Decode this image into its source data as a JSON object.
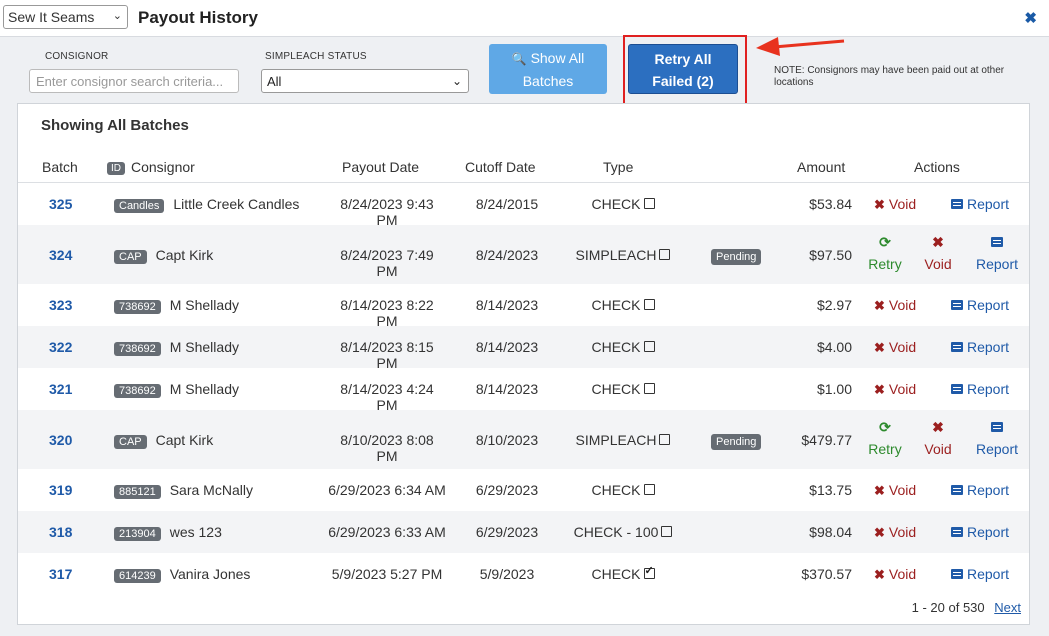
{
  "header": {
    "store_select": "Sew It Seams",
    "title": "Payout History",
    "close": "✖"
  },
  "filters": {
    "consignor_label": "CONSIGNOR",
    "consignor_placeholder": "Enter consignor search criteria...",
    "status_label": "SIMPLEACH STATUS",
    "status_value": "All",
    "show_all_line1": "Show All",
    "show_all_line2": "Batches",
    "retry_line1": "Retry All",
    "retry_line2": "Failed (2)",
    "note": "NOTE: Consignors may have been paid out at other locations"
  },
  "table": {
    "heading": "Showing All Batches",
    "columns": {
      "batch": "Batch",
      "id_badge": "ID",
      "consignor": "Consignor",
      "payout_date": "Payout Date",
      "cutoff_date": "Cutoff Date",
      "type": "Type",
      "amount": "Amount",
      "actions": "Actions"
    },
    "action_labels": {
      "void": "Void",
      "report": "Report",
      "retry": "Retry"
    },
    "rows": [
      {
        "batch": "325",
        "tag": "Candles",
        "consignor": "Little Creek Candles",
        "payout": "8/24/2023 9:43 PM",
        "cutoff": "8/24/2015",
        "type": "CHECK",
        "checked": false,
        "pending": "",
        "amount": "$53.84",
        "retry": false
      },
      {
        "batch": "324",
        "tag": "CAP",
        "consignor": "Capt Kirk",
        "payout": "8/24/2023 7:49 PM",
        "cutoff": "8/24/2023",
        "type": "SIMPLEACH",
        "checked": false,
        "pending": "Pending",
        "amount": "$97.50",
        "retry": true
      },
      {
        "batch": "323",
        "tag": "738692",
        "consignor": "M Shellady",
        "payout": "8/14/2023 8:22 PM",
        "cutoff": "8/14/2023",
        "type": "CHECK",
        "checked": false,
        "pending": "",
        "amount": "$2.97",
        "retry": false
      },
      {
        "batch": "322",
        "tag": "738692",
        "consignor": "M Shellady",
        "payout": "8/14/2023 8:15 PM",
        "cutoff": "8/14/2023",
        "type": "CHECK",
        "checked": false,
        "pending": "",
        "amount": "$4.00",
        "retry": false
      },
      {
        "batch": "321",
        "tag": "738692",
        "consignor": "M Shellady",
        "payout": "8/14/2023 4:24 PM",
        "cutoff": "8/14/2023",
        "type": "CHECK",
        "checked": false,
        "pending": "",
        "amount": "$1.00",
        "retry": false
      },
      {
        "batch": "320",
        "tag": "CAP",
        "consignor": "Capt Kirk",
        "payout": "8/10/2023 8:08 PM",
        "cutoff": "8/10/2023",
        "type": "SIMPLEACH",
        "checked": false,
        "pending": "Pending",
        "amount": "$479.77",
        "retry": true
      },
      {
        "batch": "319",
        "tag": "885121",
        "consignor": "Sara McNally",
        "payout": "6/29/2023 6:34 AM",
        "cutoff": "6/29/2023",
        "type": "CHECK",
        "checked": false,
        "pending": "",
        "amount": "$13.75",
        "retry": false
      },
      {
        "batch": "318",
        "tag": "213904",
        "consignor": "wes 123",
        "payout": "6/29/2023 6:33 AM",
        "cutoff": "6/29/2023",
        "type": "CHECK - 100",
        "checked": false,
        "pending": "",
        "amount": "$98.04",
        "retry": false
      },
      {
        "batch": "317",
        "tag": "614239",
        "consignor": "Vanira Jones",
        "payout": "5/9/2023 5:27 PM",
        "cutoff": "5/9/2023",
        "type": "CHECK",
        "checked": true,
        "pending": "",
        "amount": "$370.57",
        "retry": false
      }
    ]
  },
  "pager": {
    "range": "1 - 20 of 530",
    "next": "Next"
  }
}
